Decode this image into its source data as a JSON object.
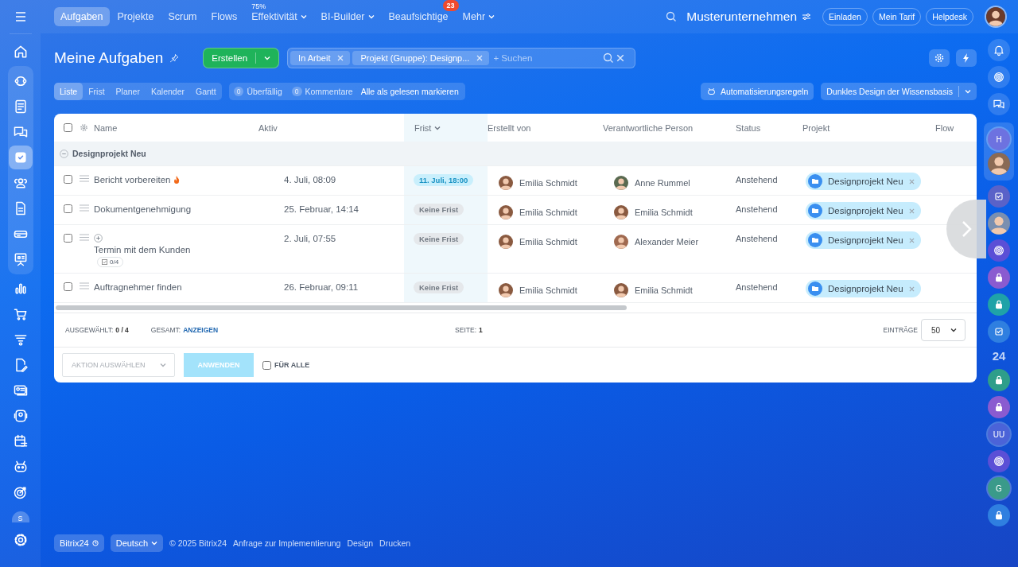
{
  "top_nav": {
    "tabs": [
      {
        "label": "Aufgaben",
        "selected": true,
        "dropdown": false
      },
      {
        "label": "Projekte",
        "selected": false,
        "dropdown": false
      },
      {
        "label": "Scrum",
        "selected": false,
        "dropdown": false
      },
      {
        "label": "Flows",
        "selected": false,
        "dropdown": false
      },
      {
        "label": "Effektivität",
        "selected": false,
        "dropdown": true,
        "note": "75%"
      },
      {
        "label": "BI-Builder",
        "selected": false,
        "dropdown": true
      },
      {
        "label": "Beaufsichtige",
        "selected": false,
        "dropdown": false,
        "badge": "23"
      },
      {
        "label": "Mehr",
        "selected": false,
        "dropdown": true
      }
    ],
    "company": "Musterunternehmen",
    "buttons": [
      "Einladen",
      "Mein Tarif",
      "Helpdesk"
    ]
  },
  "left_sidebar": {
    "pinned": [
      {
        "kind": "home",
        "selected": false
      }
    ],
    "group": [
      {
        "kind": "sync",
        "selected": false
      },
      {
        "kind": "news",
        "selected": false
      },
      {
        "kind": "chat",
        "selected": false
      },
      {
        "kind": "tasks",
        "selected": true
      },
      {
        "kind": "people",
        "selected": false
      },
      {
        "kind": "doc",
        "selected": false
      },
      {
        "kind": "drive",
        "selected": false
      },
      {
        "kind": "board",
        "selected": false
      }
    ],
    "items": [
      {
        "kind": "chart",
        "selected": false
      },
      {
        "kind": "cart",
        "selected": false
      },
      {
        "kind": "funnel",
        "selected": false
      },
      {
        "kind": "editdoc",
        "selected": false
      },
      {
        "kind": "idcard",
        "selected": false
      },
      {
        "kind": "camera",
        "selected": false
      },
      {
        "kind": "calendar",
        "selected": false
      },
      {
        "kind": "robot",
        "selected": false
      },
      {
        "kind": "target",
        "selected": false
      }
    ],
    "user_initial": "S"
  },
  "right_sidebar": {
    "items": [
      {
        "kind": "bell"
      },
      {
        "kind": "spiral"
      },
      {
        "kind": "chat"
      }
    ],
    "group": [
      {
        "kind": "initials",
        "text": "H",
        "color": "#6d72e0"
      },
      {
        "kind": "avatar",
        "color": "#8a6a55"
      }
    ],
    "more": [
      {
        "kind": "check",
        "color": "#5a62c8"
      },
      {
        "kind": "avatar",
        "color": "#7a8fb0"
      },
      {
        "kind": "spiral",
        "color": "#5b4fd6"
      },
      {
        "kind": "lock",
        "color": "#8a5bd0"
      },
      {
        "kind": "lock",
        "color": "#1fa2a8"
      },
      {
        "kind": "check",
        "color": "#2f7fe0"
      },
      {
        "kind": "text",
        "text": "24"
      },
      {
        "kind": "lock",
        "color": "#2e9e8a"
      },
      {
        "kind": "lock",
        "color": "#8a5bd0"
      },
      {
        "kind": "initials",
        "text": "UU",
        "color": "#4b63d8"
      },
      {
        "kind": "spiral",
        "color": "#5b4fd6"
      },
      {
        "kind": "initials",
        "text": "G",
        "color": "#3a9a8a"
      },
      {
        "kind": "lock",
        "color": "#2f7fe0"
      }
    ]
  },
  "page": {
    "title": "Meine Aufgaben",
    "create_button": "Erstellen",
    "filter": {
      "chips": [
        "In Arbeit",
        "Projekt (Gruppe): Designp..."
      ],
      "placeholder": "+ Suchen"
    },
    "view_tabs": [
      {
        "label": "Liste",
        "selected": true
      },
      {
        "label": "Frist",
        "selected": false
      },
      {
        "label": "Planer",
        "selected": false
      },
      {
        "label": "Kalender",
        "selected": false
      },
      {
        "label": "Gantt",
        "selected": false
      }
    ],
    "counters": [
      {
        "count": "0",
        "label": "Überfällig"
      },
      {
        "count": "0",
        "label": "Kommentare"
      }
    ],
    "mark_all_read": "Alle als gelesen markieren",
    "automation_button": "Automatisierungsregeln",
    "theme_select": "Dunkles Design der Wissensbasis"
  },
  "table": {
    "columns": [
      {
        "label": "Name",
        "sorted": false
      },
      {
        "label": "Aktiv",
        "sorted": false
      },
      {
        "label": "Frist",
        "sorted": true
      },
      {
        "label": "Erstellt von",
        "sorted": false
      },
      {
        "label": "Verantwortliche Person",
        "sorted": false
      },
      {
        "label": "Status",
        "sorted": false
      },
      {
        "label": "Projekt",
        "sorted": false
      },
      {
        "label": "Flow",
        "sorted": false
      }
    ],
    "all_checked": false,
    "groups": [
      {
        "title": "Designprojekt Neu",
        "expanded": true,
        "rows": [
          {
            "checked": false,
            "name": "Bericht vorbereiten",
            "hot": true,
            "subtasks": false,
            "active": "4. Juli, 08:09",
            "deadline": {
              "kind": "date",
              "text": "11. Juli, 18:00"
            },
            "created_by": {
              "name": "Emilia Schmidt",
              "color": "#8a5a40"
            },
            "responsible": {
              "name": "Anne Rummel",
              "color": "#5a6a50"
            },
            "status": "Anstehend",
            "project": "Designprojekt Neu"
          },
          {
            "checked": false,
            "name": "Dokumentgenehmigung",
            "hot": false,
            "subtasks": false,
            "active": "25. Februar, 14:14",
            "deadline": {
              "kind": "none",
              "text": "Keine Frist"
            },
            "created_by": {
              "name": "Emilia Schmidt",
              "color": "#8a5a40"
            },
            "responsible": {
              "name": "Emilia Schmidt",
              "color": "#8a5a40"
            },
            "status": "Anstehend",
            "project": "Designprojekt Neu"
          },
          {
            "checked": false,
            "name": "Termin mit dem Kunden",
            "hot": false,
            "subtasks": true,
            "checklist": "0/4",
            "active": "2. Juli, 07:55",
            "deadline": {
              "kind": "none",
              "text": "Keine Frist"
            },
            "created_by": {
              "name": "Emilia Schmidt",
              "color": "#8a5a40"
            },
            "responsible": {
              "name": "Alexander Meier",
              "color": "#a06a50"
            },
            "status": "Anstehend",
            "project": "Designprojekt Neu"
          },
          {
            "checked": false,
            "name": "Auftragnehmer finden",
            "hot": false,
            "subtasks": false,
            "active": "26. Februar, 09:11",
            "deadline": {
              "kind": "none",
              "text": "Keine Frist"
            },
            "created_by": {
              "name": "Emilia Schmidt",
              "color": "#8a5a40"
            },
            "responsible": {
              "name": "Emilia Schmidt",
              "color": "#8a5a40"
            },
            "status": "Anstehend",
            "project": "Designprojekt Neu"
          }
        ]
      }
    ],
    "footer": {
      "selected_label": "AUSGEWÄHLT:",
      "selected_value": "0 / 4",
      "total_label": "GESAMT:",
      "total_link": "ANZEIGEN",
      "page_label": "SEITE:",
      "page_value": "1",
      "entries_label": "EINTRÄGE",
      "entries_value": "50"
    },
    "actions": {
      "action_select": "AKTION AUSWÄHLEN",
      "apply_button": "ANWENDEN",
      "for_all_label": "FÜR ALLE",
      "for_all_checked": false
    }
  },
  "bottom_footer": {
    "brand": "Bitrix24",
    "language": "Deutsch",
    "copyright": "© 2025 Bitrix24",
    "links": [
      "Anfrage zur Implementierung",
      "Design",
      "Drucken"
    ]
  }
}
